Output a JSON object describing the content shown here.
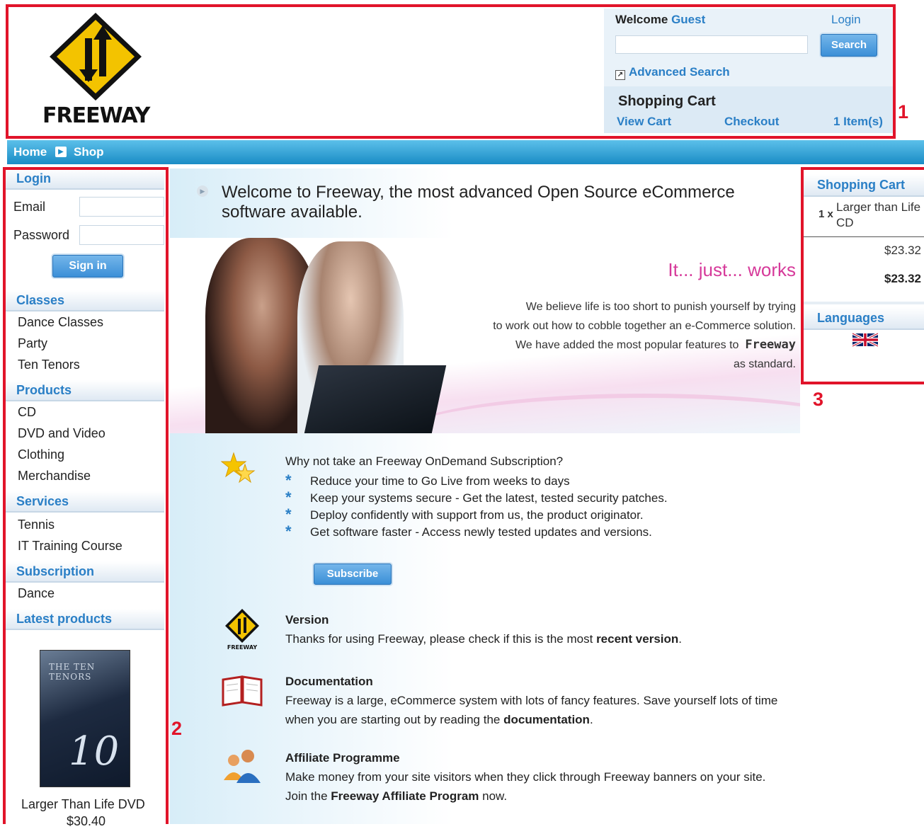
{
  "header": {
    "logo_text": "FREEWAY",
    "welcome_prefix": "Welcome",
    "welcome_user": "Guest",
    "login_link": "Login",
    "search_placeholder": "",
    "search_button": "Search",
    "advanced_search": "Advanced Search",
    "cart_title": "Shopping Cart",
    "view_cart": "View Cart",
    "checkout": "Checkout",
    "item_count": "1 Item(s)"
  },
  "breadcrumb": {
    "home": "Home",
    "shop": "Shop"
  },
  "left": {
    "login_title": "Login",
    "email_label": "Email",
    "password_label": "Password",
    "signin_button": "Sign in",
    "classes_title": "Classes",
    "classes": [
      "Dance Classes",
      "Party",
      "Ten Tenors"
    ],
    "products_title": "Products",
    "products": [
      "CD",
      "DVD and Video",
      "Clothing",
      "Merchandise"
    ],
    "services_title": "Services",
    "services": [
      "Tennis",
      "IT Training Course"
    ],
    "subscription_title": "Subscription",
    "subscriptions": [
      "Dance"
    ],
    "latest_title": "Latest products",
    "latest_cover_title": "THE TEN TENORS",
    "latest_cover_number": "10",
    "latest_name": "Larger Than Life DVD",
    "latest_price": "$30.40"
  },
  "center": {
    "welcome": "Welcome to Freeway, the most advanced Open Source eCommerce software available.",
    "slogan": "It... just... works",
    "hero_line1": "We believe life is too short to punish yourself by trying",
    "hero_line2": "to work out how to cobble together an e-Commerce solution.",
    "hero_line3": "We have added the most popular features to",
    "hero_brand": "Freeway",
    "hero_line4": "as standard.",
    "ondemand_question": "Why not take an  Freeway OnDemand Subscription?",
    "benefits": [
      "Reduce your time to Go Live from weeks to days",
      "Keep your systems secure - Get the latest, tested security patches.",
      "Deploy confidently with support from us, the product originator.",
      "Get software faster - Access newly tested updates and versions."
    ],
    "subscribe_button": "Subscribe",
    "version_title": "Version",
    "version_text": "Thanks for using Freeway, please check if this is the most",
    "version_bold": "recent version",
    "documentation_title": "Documentation",
    "documentation_text": "Freeway is a large, eCommerce system with lots of fancy features. Save yourself lots of time when you are starting out by reading the",
    "documentation_bold": "documentation",
    "affiliate_title": "Affiliate Programme",
    "affiliate_text1": "Make money from your site visitors when they click through Freeway banners on your site.",
    "affiliate_text2": "Join the",
    "affiliate_bold": "Freeway Affiliate Program",
    "affiliate_text3": "now."
  },
  "right": {
    "cart_title": "Shopping Cart",
    "qty": "1 x",
    "item": "Larger than Life CD",
    "subtotal": "$23.32",
    "total": "$23.32",
    "languages_title": "Languages"
  },
  "callouts": {
    "one": "1",
    "two": "2",
    "three": "3"
  },
  "colors": {
    "accent": "#2a7fc6",
    "callout": "#e1142a",
    "nav": "#1a8cc5",
    "slogan": "#d63a9a"
  }
}
